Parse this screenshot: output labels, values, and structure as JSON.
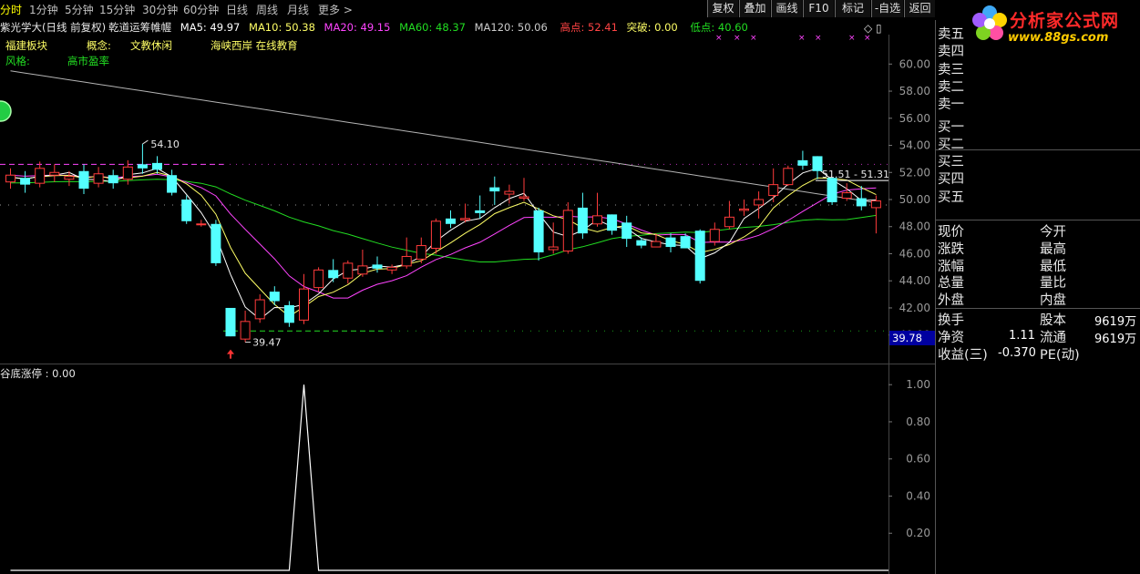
{
  "toolbar": {
    "periods": [
      "分时",
      "1分钟",
      "5分钟",
      "15分钟",
      "30分钟",
      "60分钟",
      "日线",
      "周线",
      "月线",
      "更多 >"
    ],
    "active_period": "日线",
    "buttons": [
      "复权",
      "叠加",
      "画线",
      "F10",
      "标记",
      "-自选",
      "返回"
    ]
  },
  "header": {
    "title": "紫光学大(日线 前复权)",
    "indicator_name": "乾道运筹帷幄",
    "ma5": "MA5: 49.97",
    "ma10": "MA10: 50.38",
    "ma20": "MA20: 49.15",
    "ma60": "MA60: 48.37",
    "ma120": "MA120: 50.06",
    "high": "高点: 52.41",
    "breakout": "突破: 0.00",
    "low": "低点: 40.60"
  },
  "tags": {
    "sector_label": "福建板块",
    "concept_label": "概念:",
    "concept_value": "文教休闲",
    "concept_value2": "海峡西岸 在线教育",
    "style_label": "风格:",
    "style_value": "高市盈率"
  },
  "colors": {
    "up": "#ff3b3b",
    "down": "#54ffff",
    "ma5": "#ffffff",
    "ma10": "#ffff66",
    "ma20": "#ff44ff",
    "ma60": "#22dd22",
    "ma120": "#b4b4b4",
    "accent_yellow": "#ffff00"
  },
  "chart_data": {
    "type": "candlestick",
    "y_axis_ticks": [
      "60.00",
      "58.00",
      "56.00",
      "54.00",
      "52.00",
      "50.00",
      "48.00",
      "46.00",
      "44.00",
      "42.00",
      "40.00"
    ],
    "ylim": [
      38.5,
      61.5
    ],
    "annotations": {
      "peak_label": "54.10",
      "low_label": "39.47",
      "range_label": "51.51 - 51.31",
      "cursor_price": "39.78"
    },
    "candles": [
      [
        51.3,
        51.8,
        52.3,
        50.8
      ],
      [
        51.6,
        51.1,
        52.1,
        50.5
      ],
      [
        51.2,
        52.3,
        52.8,
        50.9
      ],
      [
        51.8,
        52.0,
        52.6,
        51.3
      ],
      [
        51.5,
        51.7,
        52.1,
        51.0
      ],
      [
        52.1,
        50.8,
        52.6,
        50.4
      ],
      [
        51.2,
        51.9,
        52.4,
        50.9
      ],
      [
        51.8,
        51.2,
        52.2,
        50.8
      ],
      [
        51.5,
        52.4,
        52.9,
        51.1
      ],
      [
        52.6,
        52.3,
        54.1,
        51.9
      ],
      [
        52.7,
        52.2,
        53.2,
        51.9
      ],
      [
        51.8,
        50.5,
        52.2,
        50.3
      ],
      [
        50.0,
        48.4,
        50.3,
        48.2
      ],
      [
        48.2,
        48.2,
        48.5,
        48.0
      ],
      [
        48.2,
        45.3,
        48.5,
        45.1
      ],
      [
        42.0,
        39.9,
        42.0,
        39.9
      ],
      [
        39.7,
        41.0,
        41.8,
        39.47
      ],
      [
        41.2,
        42.6,
        43.0,
        40.9
      ],
      [
        43.2,
        42.5,
        43.6,
        42.2
      ],
      [
        42.2,
        40.9,
        42.5,
        40.6
      ],
      [
        41.1,
        43.4,
        44.5,
        40.8
      ],
      [
        43.5,
        44.8,
        45.0,
        43.2
      ],
      [
        44.8,
        44.2,
        45.6,
        43.9
      ],
      [
        44.2,
        45.3,
        45.5,
        43.8
      ],
      [
        44.5,
        45.1,
        46.3,
        44.3
      ],
      [
        45.2,
        44.9,
        45.8,
        44.6
      ],
      [
        44.8,
        45.0,
        45.2,
        44.5
      ],
      [
        45.1,
        45.8,
        47.2,
        44.9
      ],
      [
        45.6,
        46.6,
        47.2,
        45.3
      ],
      [
        46.4,
        48.4,
        48.6,
        46.0
      ],
      [
        48.6,
        48.2,
        49.2,
        47.9
      ],
      [
        48.5,
        48.6,
        49.7,
        48.3
      ],
      [
        49.2,
        49.0,
        50.3,
        48.6
      ],
      [
        50.9,
        50.6,
        51.7,
        49.6
      ],
      [
        50.4,
        50.6,
        51.1,
        49.7
      ],
      [
        50.1,
        50.2,
        51.6,
        49.9
      ],
      [
        49.2,
        46.1,
        49.4,
        45.5
      ],
      [
        46.3,
        46.5,
        48.3,
        46.0
      ],
      [
        46.2,
        49.2,
        49.8,
        46.0
      ],
      [
        49.4,
        47.5,
        50.5,
        47.1
      ],
      [
        48.2,
        48.8,
        50.5,
        48.0
      ],
      [
        48.9,
        47.7,
        48.9,
        47.4
      ],
      [
        48.3,
        47.1,
        48.8,
        46.5
      ],
      [
        47.0,
        46.6,
        47.2,
        46.4
      ],
      [
        46.5,
        46.9,
        47.5,
        46.5
      ],
      [
        47.2,
        46.5,
        47.5,
        46.1
      ],
      [
        47.3,
        46.4,
        47.5,
        46.4
      ],
      [
        47.7,
        44.0,
        47.8,
        43.8
      ],
      [
        46.9,
        47.8,
        48.3,
        46.6
      ],
      [
        48.0,
        48.7,
        49.9,
        47.8
      ],
      [
        49.2,
        49.3,
        50.0,
        48.8
      ],
      [
        49.6,
        50.0,
        50.6,
        48.6
      ],
      [
        50.3,
        51.1,
        52.3,
        49.8
      ],
      [
        51.1,
        52.3,
        52.5,
        51.0
      ],
      [
        52.9,
        52.5,
        53.6,
        52.2
      ],
      [
        53.2,
        52.1,
        53.2,
        51.5
      ],
      [
        51.6,
        49.8,
        51.6,
        49.6
      ],
      [
        50.1,
        50.5,
        51.2,
        49.9
      ],
      [
        50.1,
        49.5,
        51.0,
        49.2
      ],
      [
        49.4,
        49.9,
        50.3,
        47.5
      ]
    ],
    "sub_indicator": {
      "label": "谷底涨停 : 0.00",
      "y_axis_ticks": [
        "1.00",
        "0.80",
        "0.60",
        "0.40",
        "0.20"
      ],
      "ylim": [
        0,
        1.05
      ],
      "values": [
        0,
        0,
        0,
        0,
        0,
        0,
        0,
        0,
        0,
        0,
        0,
        0,
        0,
        0,
        0,
        0,
        0,
        0,
        0,
        0,
        1,
        0,
        0,
        0,
        0,
        0,
        0,
        0,
        0,
        0,
        0,
        0,
        0,
        0,
        0,
        0,
        0,
        0,
        0,
        0,
        0,
        0,
        0,
        0,
        0,
        0,
        0,
        0,
        0,
        0,
        0,
        0,
        0,
        0,
        0,
        0,
        0,
        0,
        0,
        0
      ]
    }
  },
  "quote_panel": {
    "order_book": [
      "卖五",
      "卖四",
      "卖三",
      "卖二",
      "卖一",
      "买一",
      "买二",
      "买三",
      "买四",
      "买五"
    ],
    "left_labels": [
      "现价",
      "涨跌",
      "涨幅",
      "总量",
      "外盘"
    ],
    "right_labels": [
      "今开",
      "最高",
      "最低",
      "量比",
      "内盘"
    ],
    "fund": {
      "turnover_label": "换手",
      "shares_label": "股本",
      "shares_value": "9619万",
      "nav_label": "净资",
      "nav_value": "1.11",
      "float_label": "流通",
      "float_value": "9619万",
      "eps_label": "收益(三)",
      "eps_value": "-0.370",
      "pe_label": "PE(动)"
    }
  },
  "watermark": {
    "brand": "分析家公式网",
    "url": "www.88gs.com"
  }
}
